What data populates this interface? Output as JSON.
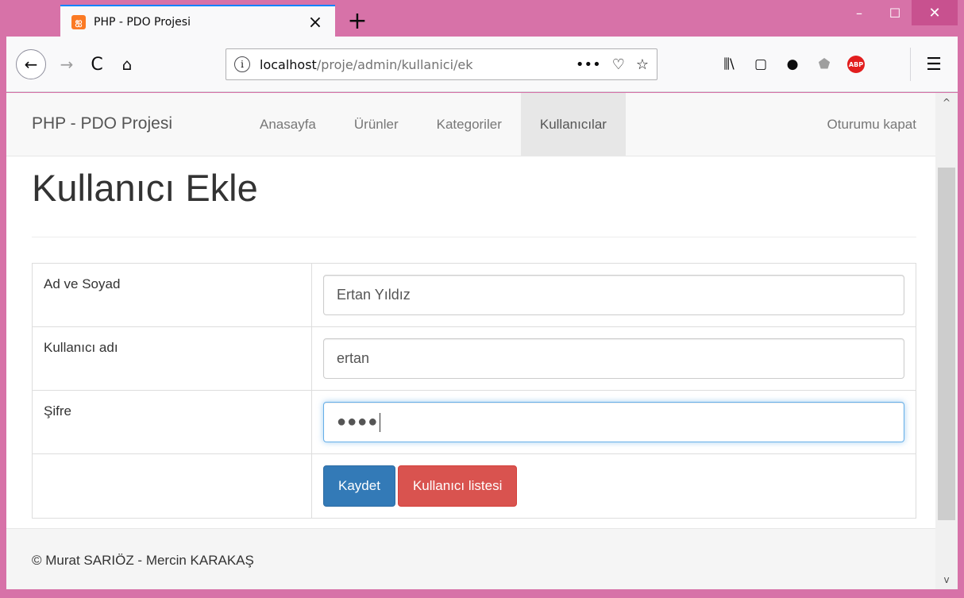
{
  "browser": {
    "tab": {
      "title": "PHP - PDO Projesi",
      "favicon": "xampp-icon",
      "close_glyph": "×"
    },
    "new_tab_glyph": "+",
    "window_controls": {
      "minimize": "–",
      "maximize": "☐",
      "close": "✕"
    },
    "nav": {
      "back": "←",
      "forward": "→",
      "reload": "C",
      "home": "⌂"
    },
    "url": {
      "host": "localhost",
      "path": "/proje/admin/kullanici/ek"
    },
    "url_actions": {
      "more": "•••",
      "pocket": "♡",
      "bookmark": "☆"
    },
    "toolbar": {
      "library": "⫼\\",
      "sidebar": "▢",
      "ext1": "●",
      "ext2": "⬟",
      "abp": "ABP",
      "menu": "☰"
    },
    "scroll": {
      "up": "^",
      "down": "v"
    }
  },
  "site": {
    "brand": "PHP - PDO Projesi",
    "nav_items": [
      "Anasayfa",
      "Ürünler",
      "Kategoriler",
      "Kullanıcılar"
    ],
    "active_nav": "Kullanıcılar",
    "logout": "Oturumu kapat"
  },
  "page": {
    "title": "Kullanıcı Ekle",
    "form": {
      "name_label": "Ad ve Soyad",
      "name_value": "Ertan Yıldız",
      "username_label": "Kullanıcı adı",
      "username_value": "ertan",
      "password_label": "Şifre",
      "password_value": "●●●●",
      "save_button": "Kaydet",
      "list_button": "Kullanıcı listesi"
    },
    "footer": "© Murat SARIÖZ - Mercin KARAKAŞ"
  },
  "colors": {
    "window_frame": "#d772a8",
    "primary": "#337ab7",
    "danger": "#d9534f",
    "focus": "#66afe9"
  }
}
